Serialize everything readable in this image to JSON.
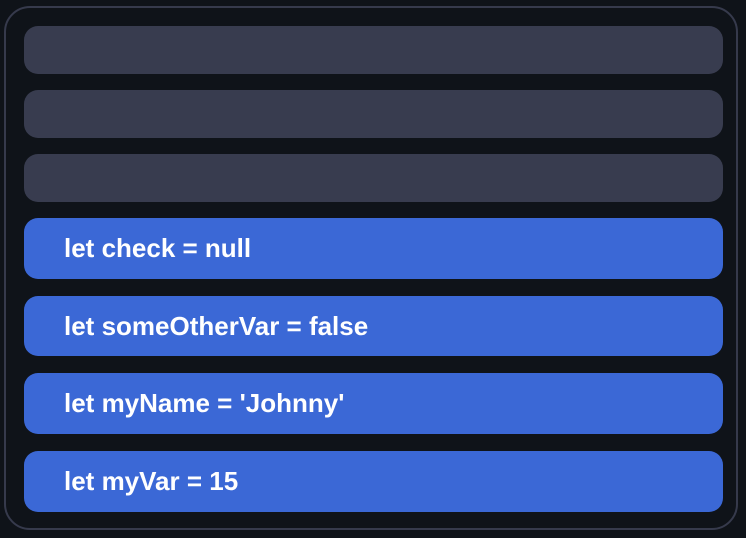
{
  "drop_slots": [
    "",
    "",
    ""
  ],
  "items": [
    {
      "label": "let check = null"
    },
    {
      "label": "let someOtherVar = false"
    },
    {
      "label": "let myName = 'Johnny'"
    },
    {
      "label": "let myVar = 15"
    }
  ],
  "colors": {
    "background": "#0f1319",
    "slot": "#383c4f",
    "item": "#3b68d6",
    "border": "#363a4c"
  }
}
